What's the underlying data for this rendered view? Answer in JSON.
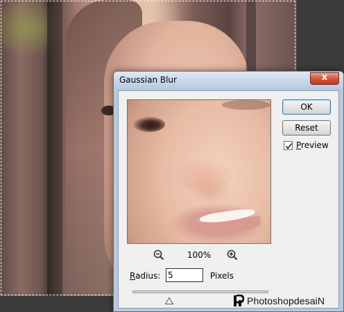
{
  "background_image": {
    "description_icon": "portrait-photo"
  },
  "dialog": {
    "title": "Gaussian Blur",
    "close_label": "x",
    "zoom": {
      "level": "100%",
      "zoom_out_icon": "zoom-out-icon",
      "zoom_in_icon": "zoom-in-icon"
    },
    "radius": {
      "label_prefix": "R",
      "label_rest": "adius:",
      "value": "5",
      "units": "Pixels",
      "slider_fraction": 0.27
    },
    "buttons": {
      "ok": "OK",
      "reset": "Reset"
    },
    "preview": {
      "checked": true,
      "label_prefix": "P",
      "label_rest": "review"
    }
  },
  "watermark": {
    "text": "PhotoshopdesaiN"
  },
  "colors": {
    "title_bar": "#c4d5e8",
    "close_button": "#d5583c",
    "dialog_body": "#f0f0f0",
    "marquee": "#f5f5f5"
  }
}
